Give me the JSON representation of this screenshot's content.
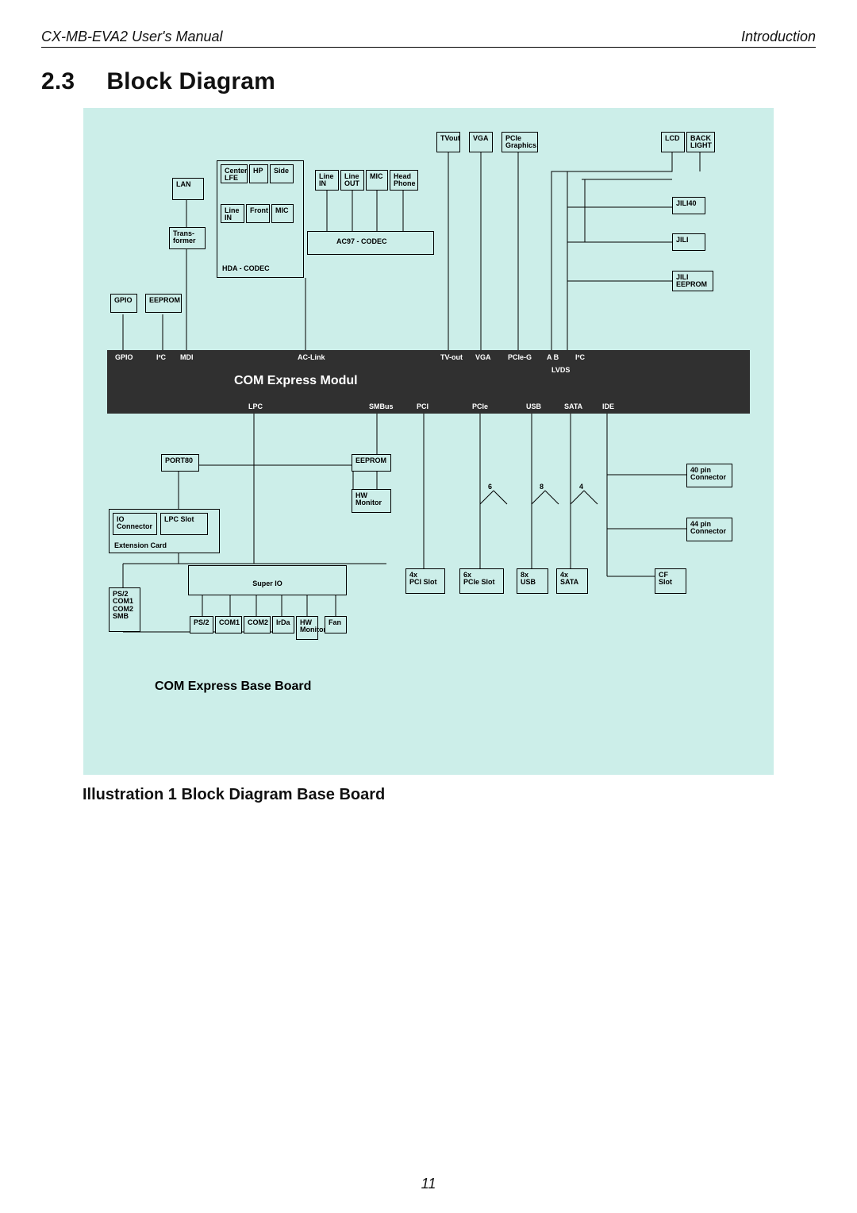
{
  "header": {
    "left": "CX-MB-EVA2  User's Manual",
    "right": "Introduction"
  },
  "section": {
    "number": "2.3",
    "title": "Block Diagram"
  },
  "caption": "Illustration 1   Block Diagram Base Board",
  "page_number": "11",
  "module": {
    "title": "COM Express Modul",
    "pins_top": [
      "GPIO",
      "I²C",
      "MDI",
      "AC-Link",
      "TV-out",
      "VGA",
      "PCIe-G",
      "A B",
      "I²C"
    ],
    "lvds": "LVDS",
    "pins_bottom": [
      "LPC",
      "SMBus",
      "PCI",
      "PCIe",
      "USB",
      "SATA",
      "IDE"
    ]
  },
  "base": {
    "title": "COM Express Base Board"
  },
  "topRow": {
    "tvout": "TVout",
    "vga": "VGA",
    "pcie_gfx1": "PCIe",
    "pcie_gfx2": "Graphics",
    "lcd": "LCD",
    "backlight1": "BACK",
    "backlight2": "LIGHT",
    "jili40": "JILI40",
    "jili": "JILI",
    "jili_eeprom1": "JILI",
    "jili_eeprom2": "EEPROM"
  },
  "lan": {
    "lan": "LAN",
    "trans1": "Trans-",
    "trans2": "former"
  },
  "gpio": "GPIO",
  "eeprom": "EEPROM",
  "audioBox": {
    "center1": "Center",
    "center2": "LFE",
    "hp": "HP",
    "side": "Side",
    "line_in": "Line",
    "line_in2": "IN",
    "front": "Front",
    "mic": "MIC",
    "ac97": "AC97 -  CODEC",
    "hda": "HDA - CODEC"
  },
  "audioPins": {
    "line_in": "Line",
    "line_in2": "IN",
    "line_out": "Line",
    "line_out2": "OUT",
    "mic": "MIC",
    "head1": "Head",
    "head2": "Phone"
  },
  "bus_counts": {
    "pci": "6",
    "pcie": "8",
    "usb": "4"
  },
  "below": {
    "port80": "PORT80",
    "eeprom": "EEPROM",
    "hw": "HW",
    "monitor": "Monitor",
    "io1": "IO",
    "io2": "Connector",
    "lpc_slot": "LPC Slot",
    "ext_card": "Extension Card",
    "super_io": "Super IO",
    "ps2_top": "PS/2",
    "com1_top": "COM1",
    "com2_top": "COM2",
    "smb_top": "SMB",
    "ps2": "PS/2",
    "com1": "COM1",
    "com2": "COM2",
    "irda": "IrDa",
    "hw2": "HW",
    "monitor2": "Monitor",
    "fan": "Fan",
    "pci_x": "4x",
    "pci_slot": "PCI Slot",
    "pcie_x": "6x",
    "pcie_slot": "PCIe Slot",
    "usb_x": "8x",
    "usb": "USB",
    "sata_x": "4x",
    "sata": "SATA",
    "cf1": "CF",
    "cf2": "Slot",
    "pin40a": "40 pin",
    "pin40b": "Connector",
    "pin44a": "44 pin",
    "pin44b": "Connector"
  }
}
